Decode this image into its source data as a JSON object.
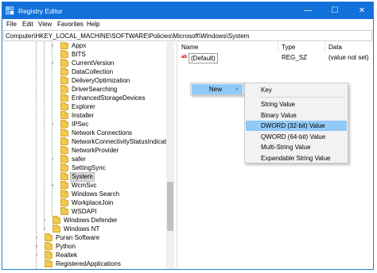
{
  "window": {
    "title": "Registry Editor",
    "controls": {
      "minimize": "—",
      "maximize": "☐",
      "close": "✕"
    },
    "accent_color": "#1170d9"
  },
  "menu": [
    "File",
    "Edit",
    "View",
    "Favorites",
    "Help"
  ],
  "address": "Computer\\HKEY_LOCAL_MACHINE\\SOFTWARE\\Policies\\Microsoft\\Windows\\System",
  "tree": {
    "items": [
      "Appx",
      "BITS",
      "CurrentVersion",
      "DataCollection",
      "DeliveryOptimization",
      "DriverSearching",
      "EnhancedStorageDevices",
      "Explorer",
      "Installer",
      "IPSec",
      "Network Connections",
      "NetworkConnectivityStatusIndicator",
      "NetworkProvider",
      "safer",
      "SettingSync",
      "System",
      "WcmSvc",
      "Windows Search",
      "WorkplaceJoin",
      "WSDAPI",
      "Windows Defender",
      "Windows NT",
      "Puran Software",
      "Python",
      "Realtek",
      "RegisteredApplications"
    ],
    "selected": "System"
  },
  "values_pane": {
    "headers": {
      "name": "Name",
      "type": "Type",
      "data": "Data"
    },
    "rows": [
      {
        "icon": "ab",
        "name": "(Default)",
        "type": "REG_SZ",
        "data": "(value not set)"
      }
    ]
  },
  "context_menu": {
    "new_label": "New",
    "arrow": "›",
    "submenu": [
      "Key",
      "String Value",
      "Binary Value",
      "DWORD (32-bit) Value",
      "QWORD (64-bit) Value",
      "Multi-String Value",
      "Expandable String Value"
    ],
    "highlighted": "DWORD (32-bit) Value",
    "highlight_color": "#91c9f7"
  }
}
